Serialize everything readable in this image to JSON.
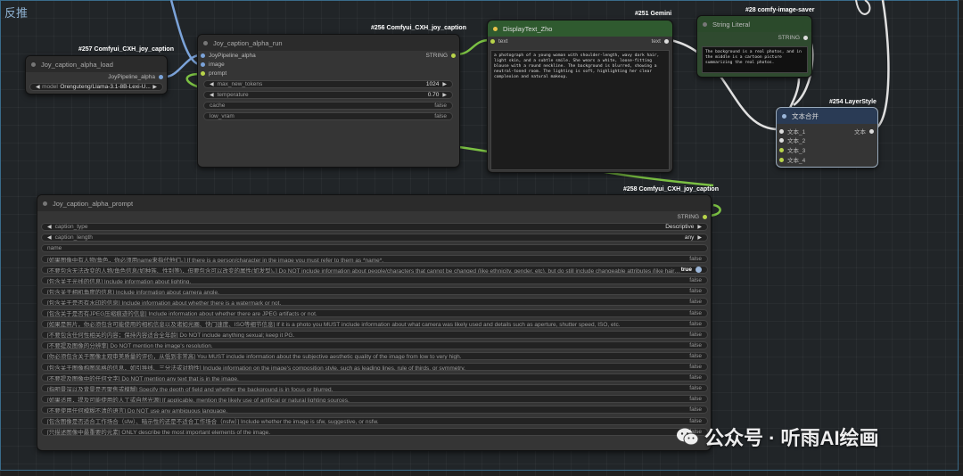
{
  "group": {
    "title": "反推"
  },
  "nodes": {
    "load": {
      "badge": "#257 Comfyui_CXH_joy_caption",
      "title": "Joy_caption_alpha_load",
      "output": "JoyPipeline_alpha",
      "model_label": "model",
      "model_value": "Orenguteng/Llama-3.1-8B-Lexi-U..."
    },
    "run": {
      "badge": "#256 Comfyui_CXH_joy_caption",
      "title": "Joy_caption_alpha_run",
      "inputs": [
        "JoyPipeline_alpha",
        "image",
        "prompt"
      ],
      "output": "STRING",
      "widgets": [
        {
          "label": "max_new_tokens",
          "value": "1024"
        },
        {
          "label": "temperature",
          "value": "0.70"
        },
        {
          "label": "cache",
          "value": "false"
        },
        {
          "label": "low_vram",
          "value": "false"
        }
      ]
    },
    "display": {
      "badge": "#251 Gemini",
      "title": "DisplayText_Zho",
      "input": "text",
      "output": "text",
      "text": "a photograph of a young woman with shoulder-length, wavy dark hair, light skin, and a subtle smile. She wears a white, loose-fitting blouse with a round neckline. The background is blurred, showing a neutral-toned room. The lighting is soft, highlighting her clear complexion and natural makeup."
    },
    "string": {
      "badge": "#28 comfy-image-saver",
      "title": "String Literal",
      "output": "STRING",
      "text": "The background is a real photos, and in the middle is a cartoon picture summarizing the real photos."
    },
    "layer": {
      "badge": "#254 LayerStyle",
      "title": "文本合并",
      "inputs": [
        "文本_1",
        "文本_2",
        "文本_3",
        "文本_4"
      ],
      "output": "文本"
    },
    "prompt": {
      "badge": "#258 Comfyui_CXH_joy_caption",
      "title": "Joy_caption_alpha_prompt",
      "output": "STRING",
      "selects": [
        {
          "label": "caption_type",
          "value": "Descriptive"
        },
        {
          "label": "caption_length",
          "value": "any"
        }
      ],
      "name_label": "name",
      "options": [
        {
          "label": "[如果图像中有人物/角色，你必须用name来指代他们。] If there is a person/character in the image you must refer to them as *name*.",
          "value": "false"
        },
        {
          "label": "[不要包含无法改变的人物/角色信息(如种族、性别等)，但要包含可以改变的属性(如发型)。] Do NOT include information about people/characters that cannot be changed (like ethnicity, gender, etc), but do still include changeable attributes (like hair style).",
          "value": "true"
        },
        {
          "label": "[包含关于光线的信息] Include information about lighting.",
          "value": "false"
        },
        {
          "label": "[包含关于相机角度的信息] Include information about camera angle.",
          "value": "false"
        },
        {
          "label": "[包含关于是否有水印的信息] Include information about whether there is a watermark or not.",
          "value": "false"
        },
        {
          "label": "[包含关于是否有JPEG压缩痕迹的信息] Include information about whether there are JPEG artifacts or not.",
          "value": "false"
        },
        {
          "label": "[如果是照片，你必须包含可能使用的相机信息以及诸如光圈、快门速度、ISO等细节信息] If it is a photo you MUST include information about what camera was likely used and details such as aperture, shutter speed, ISO, etc.",
          "value": "false"
        },
        {
          "label": "[不要包含任何性相关的内容；保持内容适合全年龄] Do NOT include anything sexual; keep it PG.",
          "value": "false"
        },
        {
          "label": "[不要提及图像的分辨率] Do NOT mention the image's resolution.",
          "value": "false"
        },
        {
          "label": "[你必须包含关于图像主观审美质量的评价，从低到非常高] You MUST include information about the subjective aesthetic quality of the image from low to very high.",
          "value": "false"
        },
        {
          "label": "[包含关于图像构图风格的信息，如引导线、三分法或对称性] Include information on the image's composition style, such as leading lines, rule of thirds, or symmetry.",
          "value": "false"
        },
        {
          "label": "[不要提及图像中的任何文字] Do NOT mention any text that is in the image.",
          "value": "false"
        },
        {
          "label": "[指明景深以及背景是否聚焦或模糊] Specify the depth of field and whether the background is in focus or blurred.",
          "value": "false"
        },
        {
          "label": "[如果适用，提及可能使用的人工或自然光源] If applicable, mention the likely use of artificial or natural lighting sources.",
          "value": "false"
        },
        {
          "label": "[不要使用任何模糊不清的语言] Do NOT use any ambiguous language.",
          "value": "false"
        },
        {
          "label": "[包含图像是否适合工作场合（sfw）、暗示性的还是不适合工作场合（nsfw）] Include whether the image is sfw, suggestive, or nsfw.",
          "value": "false"
        },
        {
          "label": "[只描述图像中最重要的元素] ONLY describe the most important elements of the image.",
          "value": "false"
        }
      ]
    }
  },
  "watermark": {
    "text": "公众号 · 听雨AI绘画",
    "icon": "wechat-icon"
  },
  "colors": {
    "wire_green": "#7bc043",
    "wire_white": "#e0e0e0",
    "wire_blue": "#7ba3d9",
    "group_border": "#3a6b8a"
  }
}
